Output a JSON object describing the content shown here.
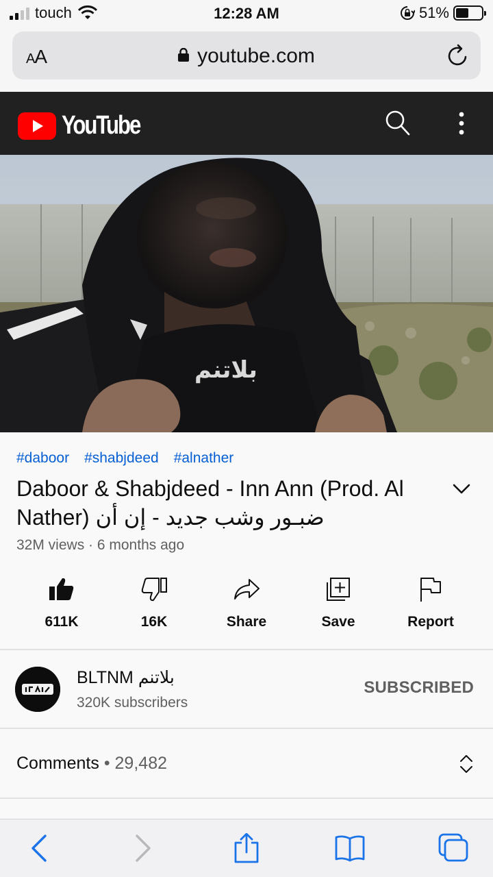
{
  "status_bar": {
    "carrier": "touch",
    "time": "12:28 AM",
    "battery_percent": "51%",
    "signal_bars": 2,
    "battery_level": 0.51
  },
  "browser": {
    "text_size_label": "AA",
    "url": "youtube.com"
  },
  "youtube_header": {
    "logo_text": "YouTube"
  },
  "video": {
    "tags": [
      "#daboor",
      "#shabjdeed",
      "#alnather"
    ],
    "title": "Daboor & Shabjdeed - Inn Ann (Prod. Al Nather) ضبـور وشب جديد - إن أن",
    "views": "32M views",
    "age": "6 months ago",
    "shirt_text": "بلاتنم"
  },
  "actions": {
    "like": "611K",
    "dislike": "16K",
    "share": "Share",
    "save": "Save",
    "report": "Report"
  },
  "channel": {
    "name": "BLTNM بلاتنم",
    "subscribers": "320K subscribers",
    "subscribe_status": "SUBSCRIBED"
  },
  "comments": {
    "label": "Comments",
    "count": "29,482"
  },
  "colors": {
    "youtube_red": "#ff0000",
    "link_blue": "#065fd4",
    "header_dark": "#212121",
    "safari_blue": "#1a73e8"
  },
  "icons": [
    "signal-icon",
    "wifi-icon",
    "orientation-lock-icon",
    "battery-icon",
    "padlock-icon",
    "reload-icon",
    "youtube-play-icon",
    "search-icon",
    "more-vertical-icon",
    "like-icon",
    "dislike-icon",
    "share-icon",
    "save-playlist-icon",
    "report-flag-icon",
    "chevron-down-icon",
    "sort-icon",
    "back-icon",
    "forward-icon",
    "share-sheet-icon",
    "bookmarks-icon",
    "tabs-icon"
  ]
}
